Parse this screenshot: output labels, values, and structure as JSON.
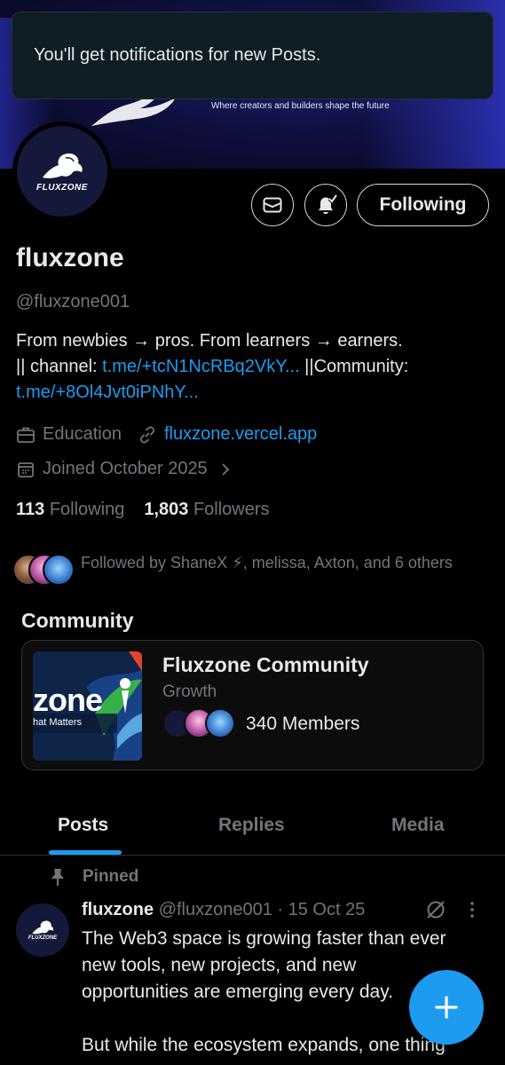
{
  "toast": {
    "message": "You'll get notifications for new Posts."
  },
  "banner": {
    "tagline": "Where creators and builders shape the future"
  },
  "profile": {
    "avatar_logo_text": "FLUXZONE",
    "display_name": "fluxzone",
    "handle": "@fluxzone001",
    "bio_line1": "From newbies → pros. From learners → earners.",
    "bio_channel_prefix": "|| channel: ",
    "bio_channel_link": "t.me/+tcN1NcRBq2VkY...",
    "bio_community_prefix": " ||Community:",
    "bio_community_link": "t.me/+8Ol4Jvt0iPNhY...",
    "category": "Education",
    "website": "fluxzone.vercel.app",
    "joined": "Joined October 2025",
    "following_count": "113",
    "following_label": "Following",
    "followers_count": "1,803",
    "followers_label": "Followers",
    "followed_by": "Followed by ShaneX ⚡, melissa, Axton, and 6 others"
  },
  "actions": {
    "message_icon": "mail-icon",
    "notify_icon": "bell-check-icon",
    "follow_label": "Following"
  },
  "community": {
    "section_title": "Community",
    "name": "Fluxzone Community",
    "category": "Growth",
    "members": "340 Members",
    "image_text_1": "zone",
    "image_text_2": "hat Matters"
  },
  "tabs": [
    {
      "label": "Posts",
      "active": true
    },
    {
      "label": "Replies",
      "active": false
    },
    {
      "label": "Media",
      "active": false
    }
  ],
  "post": {
    "pinned_label": "Pinned",
    "author": "fluxzone",
    "handle_date": "@fluxzone001 · 15 Oct 25",
    "avatar_logo_text": "FLUXZONE",
    "text_lines": [
      "The Web3 space is growing faster than ever",
      "new tools, new projects, and new",
      "opportunities are emerging every day."
    ],
    "text_line_4": "But while the ecosystem expands, one thing"
  },
  "colors": {
    "accent": "#1d9bf0",
    "muted": "#71767b",
    "text": "#e7e9ea",
    "border": "#2f3336"
  }
}
